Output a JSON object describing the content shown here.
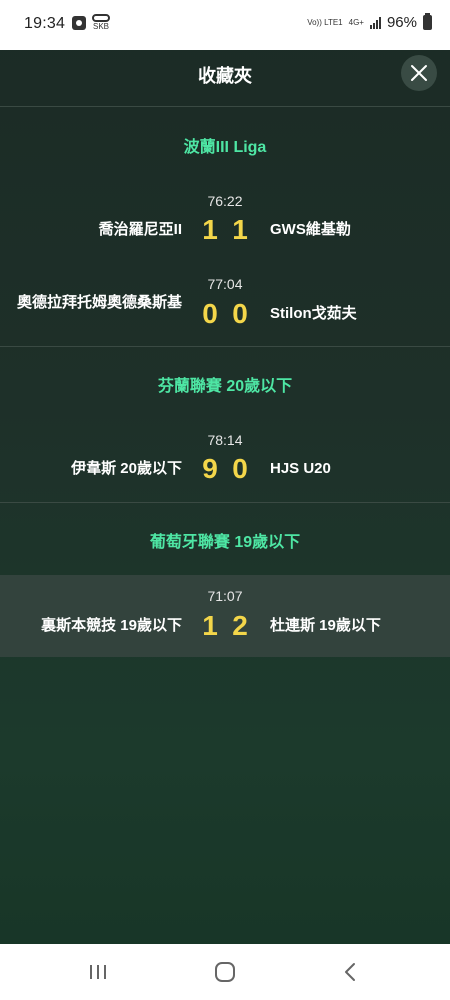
{
  "status_bar": {
    "time": "19:34",
    "volte": "Vo)) LTE1",
    "network": "4G+",
    "battery": "96%"
  },
  "header": {
    "title": "收藏夾",
    "close_icon": "close-icon"
  },
  "leagues": [
    {
      "title": "波蘭III Liga",
      "matches": [
        {
          "time": "76:22",
          "home": "喬治羅尼亞II",
          "away": "GWS維基勒",
          "home_score": "1",
          "away_score": "1"
        },
        {
          "time": "77:04",
          "home": "奧德拉拜托姆奧德桑斯基",
          "away": "Stilon戈茹夫",
          "home_score": "0",
          "away_score": "0"
        }
      ]
    },
    {
      "title": "芬蘭聯賽 20歲以下",
      "matches": [
        {
          "time": "78:14",
          "home": "伊韋斯 20歲以下",
          "away": "HJS U20",
          "home_score": "9",
          "away_score": "0"
        }
      ]
    },
    {
      "title": "葡萄牙聯賽 19歲以下",
      "matches": [
        {
          "time": "71:07",
          "home": "裏斯本競技 19歲以下",
          "away": "杜連斯 19歲以下",
          "home_score": "1",
          "away_score": "2"
        }
      ]
    }
  ],
  "colors": {
    "league_title": "#4ee6a4",
    "score": "#f3d64a",
    "background": "#1e3029"
  },
  "nav": {
    "recents_icon": "recents-icon",
    "home_icon": "home-icon",
    "back_icon": "back-icon"
  }
}
